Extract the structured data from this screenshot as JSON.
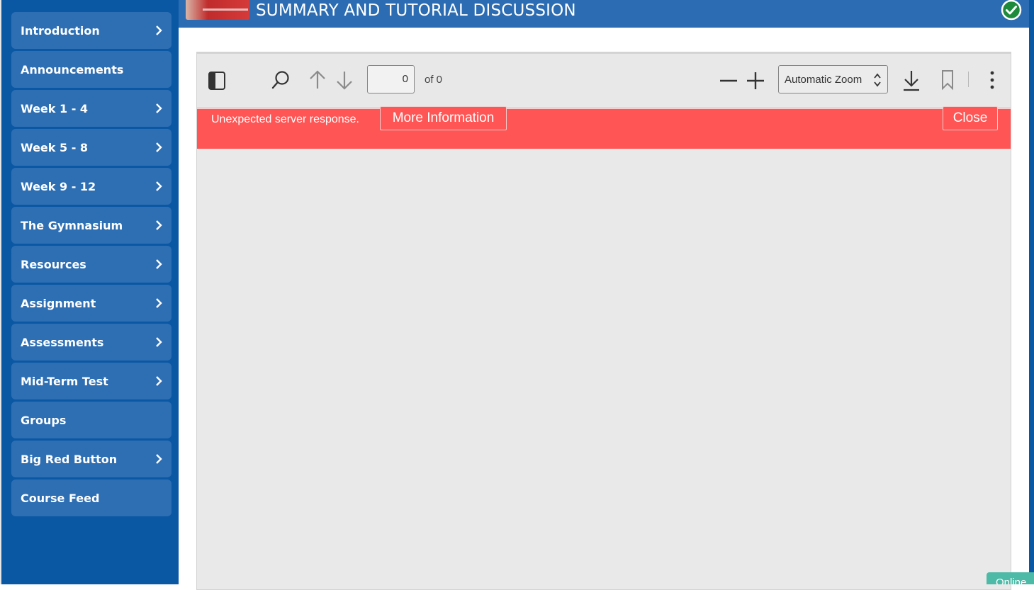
{
  "sidebar": {
    "items": [
      {
        "label": "Introduction",
        "has_chevron": true
      },
      {
        "label": "Announcements",
        "has_chevron": false
      },
      {
        "label": "Week 1 - 4",
        "has_chevron": true
      },
      {
        "label": "Week 5 - 8",
        "has_chevron": true
      },
      {
        "label": "Week 9 - 12",
        "has_chevron": true
      },
      {
        "label": "The Gymnasium",
        "has_chevron": true
      },
      {
        "label": "Resources",
        "has_chevron": true
      },
      {
        "label": "Assignment",
        "has_chevron": true
      },
      {
        "label": "Assessments",
        "has_chevron": true
      },
      {
        "label": "Mid-Term Test",
        "has_chevron": true
      },
      {
        "label": "Groups",
        "has_chevron": false
      },
      {
        "label": "Big Red Button",
        "has_chevron": true
      },
      {
        "label": "Course Feed",
        "has_chevron": false
      }
    ]
  },
  "header": {
    "title": "SUMMARY AND TUTORIAL DISCUSSION",
    "status_icon": "check-circle-icon"
  },
  "viewer": {
    "toolbar": {
      "page_value": "0",
      "page_of": "of 0",
      "zoom_value": "Automatic Zoom",
      "icons": [
        "sidebar-toggle-icon",
        "search-icon",
        "arrow-up-icon",
        "arrow-down-icon",
        "zoom-out-icon",
        "zoom-in-icon",
        "download-icon",
        "bookmark-icon",
        "more-vertical-icon"
      ]
    },
    "error": {
      "message": "Unexpected server response.",
      "more_info_label": "More Information",
      "close_label": "Close"
    }
  },
  "chat_tab": {
    "label": "Online"
  },
  "colors": {
    "sidebar_bg": "#0a57a3",
    "nav_item_bg": "#2e6fb4",
    "header_bg": "#2b6cb3",
    "error_bg": "#ff5555",
    "viewer_bg": "#e9e9e9",
    "check_green": "#1e8a3c",
    "online_tag": "#4cbaa7"
  }
}
